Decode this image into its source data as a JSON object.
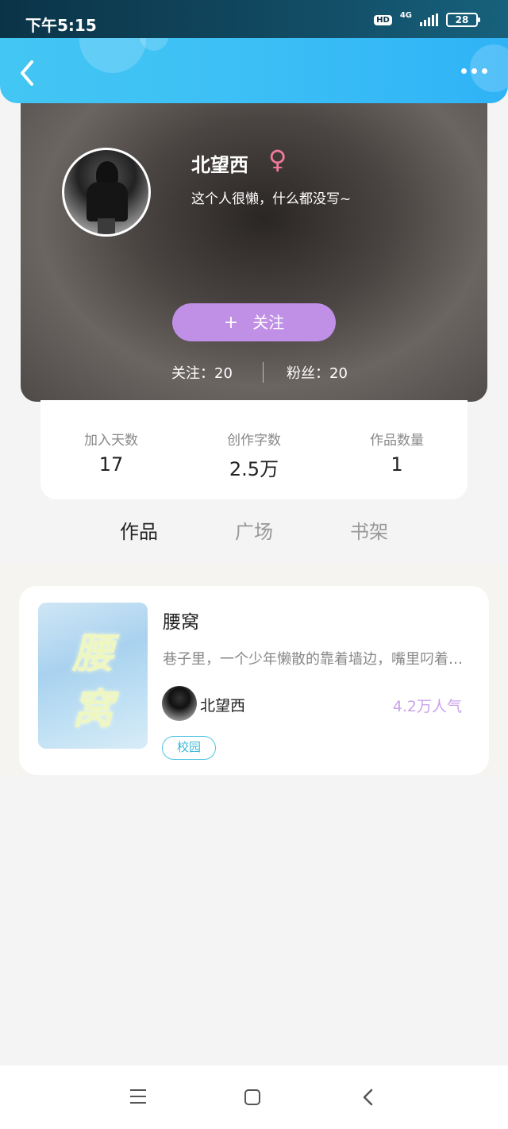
{
  "status_bar": {
    "time": "下午5:15",
    "hd": "HD",
    "network": "4G",
    "battery": "28"
  },
  "navbar": {
    "back_icon": "chevron-left-icon",
    "more_icon": "more-dots-icon",
    "color": "#3cbff5"
  },
  "profile": {
    "name": "北望西",
    "gender_symbol": "♀",
    "bio": "这个人很懒，什么都没写~",
    "follow_button": {
      "plus": "+",
      "label": "关注"
    },
    "following": "关注：20",
    "fans": "粉丝：20"
  },
  "stats": [
    {
      "label": "加入天数",
      "value": "17"
    },
    {
      "label": "创作字数",
      "value": "2.5万"
    },
    {
      "label": "作品数量",
      "value": "1"
    }
  ],
  "tabs": [
    {
      "label": "作品",
      "active": true
    },
    {
      "label": "广场",
      "active": false
    },
    {
      "label": "书架",
      "active": false
    }
  ],
  "works": [
    {
      "title": "腰窝",
      "cover_text_1": "腰",
      "cover_text_2": "窝",
      "description": "巷子里，一个少年懒散的靠着墙边，嘴里叼着一根烟……",
      "author": "北望西",
      "popularity": "4.2万人气",
      "tag": "校园"
    }
  ],
  "colors": {
    "accent_purple": "#c08fe6",
    "tag_cyan": "#4fc4e2",
    "gender_pink": "#f07a9c"
  }
}
